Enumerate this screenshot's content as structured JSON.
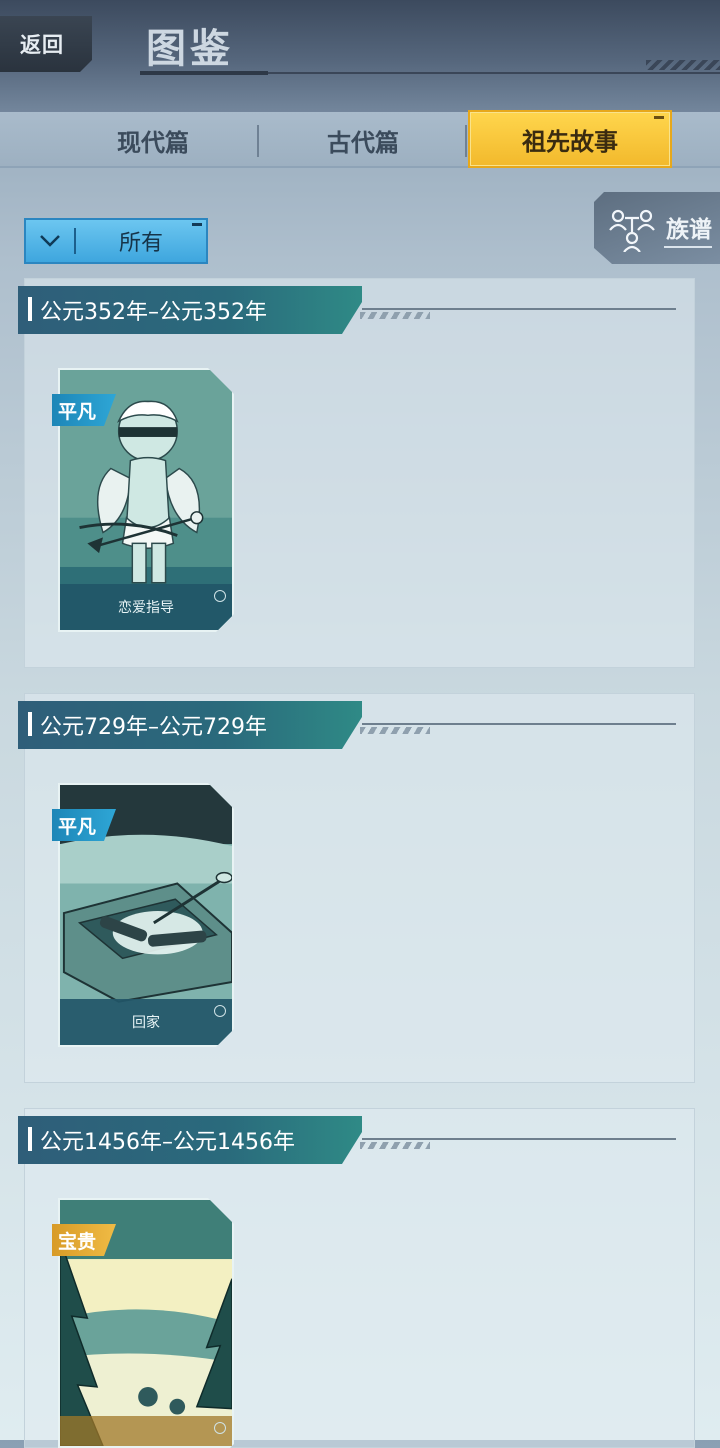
{
  "header": {
    "back_label": "返回",
    "title": "图鉴"
  },
  "tabs": [
    {
      "label": "现代篇",
      "selected": false
    },
    {
      "label": "古代篇",
      "selected": false
    },
    {
      "label": "祖先故事",
      "selected": true
    }
  ],
  "filter": {
    "selected": "所有",
    "icon": "chevron-down-icon"
  },
  "genealogy": {
    "label": "族谱",
    "icon": "family-tree-icon"
  },
  "colors": {
    "selected_tab": "#f5c232",
    "common_badge": "#2ea6d6",
    "rare_badge": "#e9ad37",
    "era_banner": "#2a6a7c"
  },
  "sections": [
    {
      "era": "公元352年–公元352年",
      "cards": [
        {
          "rarity": "平凡",
          "title": "恋爱指导"
        }
      ]
    },
    {
      "era": "公元729年–公元729年",
      "cards": [
        {
          "rarity": "平凡",
          "title": "回家"
        }
      ]
    },
    {
      "era": "公元1456年–公元1456年",
      "cards": [
        {
          "rarity": "宝贵",
          "title": ""
        }
      ]
    }
  ]
}
